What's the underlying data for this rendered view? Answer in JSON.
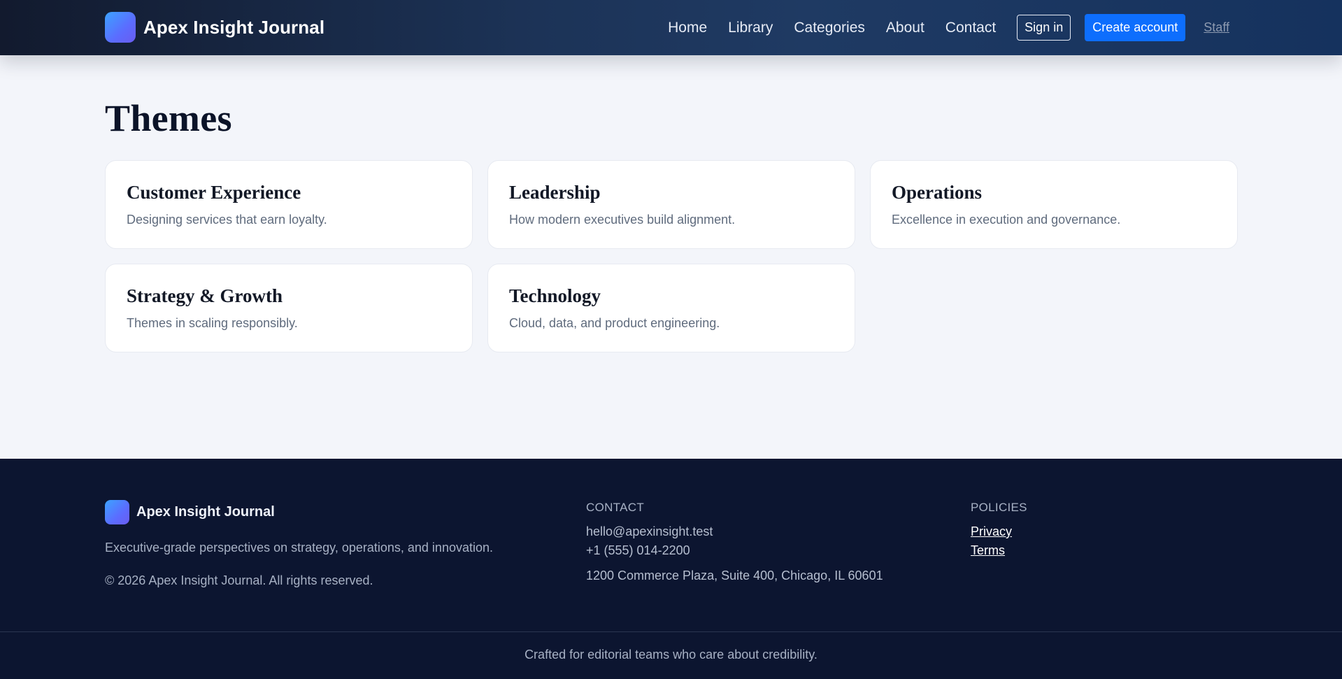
{
  "header": {
    "brand_name": "Apex Insight Journal",
    "nav": [
      "Home",
      "Library",
      "Categories",
      "About",
      "Contact"
    ],
    "sign_in": "Sign in",
    "create_account": "Create account",
    "staff": "Staff"
  },
  "main": {
    "title": "Themes",
    "cards": [
      {
        "title": "Customer Experience",
        "desc": "Designing services that earn loyalty."
      },
      {
        "title": "Leadership",
        "desc": "How modern executives build alignment."
      },
      {
        "title": "Operations",
        "desc": "Excellence in execution and governance."
      },
      {
        "title": "Strategy & Growth",
        "desc": "Themes in scaling responsibly."
      },
      {
        "title": "Technology",
        "desc": "Cloud, data, and product engineering."
      }
    ]
  },
  "footer": {
    "brand_name": "Apex Insight Journal",
    "tagline": "Executive-grade perspectives on strategy, operations, and innovation.",
    "copyright": "© 2026 Apex Insight Journal. All rights reserved.",
    "contact_heading": "CONTACT",
    "email": "hello@apexinsight.test",
    "phone": "+1 (555) 014-2200",
    "address": "1200 Commerce Plaza, Suite 400, Chicago, IL 60601",
    "policies_heading": "POLICIES",
    "privacy": "Privacy",
    "terms": "Terms",
    "bottom_note": "Crafted for editorial teams who care about credibility."
  },
  "colors": {
    "header_bg": "#1c3357",
    "accent": "#0d6efd",
    "footer_bg": "#0c1530",
    "page_bg": "#f3f5fa"
  }
}
